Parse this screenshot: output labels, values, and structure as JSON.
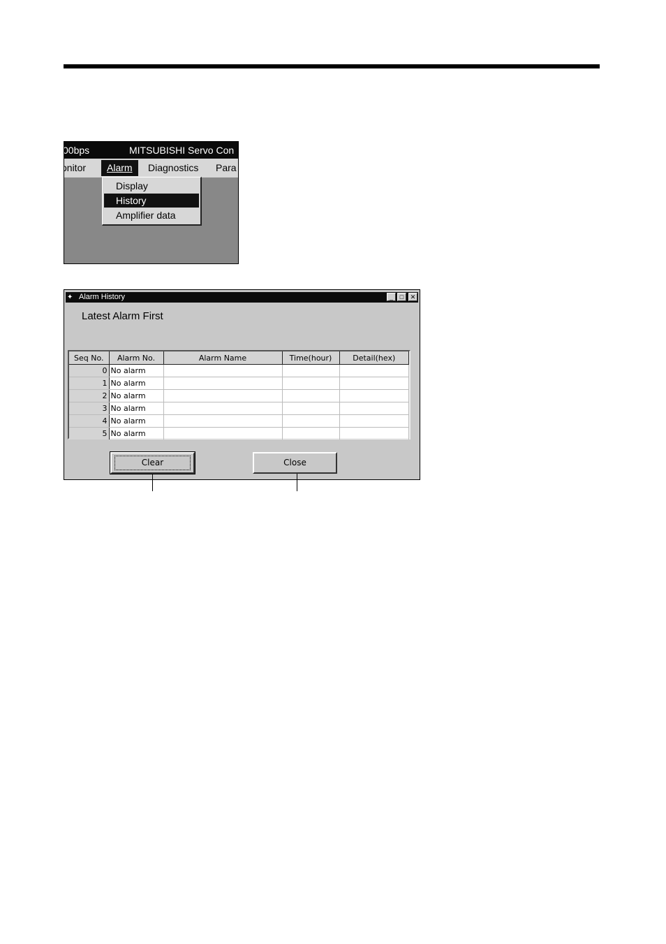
{
  "menu_screenshot": {
    "titlebar": {
      "baud": "00bps",
      "app_title": "MITSUBISHI Servo Con"
    },
    "menubar": [
      "onitor",
      "Alarm",
      "Diagnostics",
      "Para"
    ],
    "alarm_menu": [
      "Display",
      "History",
      "Amplifier data"
    ],
    "highlighted_item": "History"
  },
  "dialog": {
    "title": "Alarm History",
    "heading": "Latest Alarm First",
    "columns": [
      "Seq No.",
      "Alarm No.",
      "Alarm Name",
      "Time(hour)",
      "Detail(hex)"
    ],
    "rows": [
      {
        "seq": "0",
        "alarm_no": "No alarm",
        "alarm_name": "",
        "time": "",
        "detail": ""
      },
      {
        "seq": "1",
        "alarm_no": "No alarm",
        "alarm_name": "",
        "time": "",
        "detail": ""
      },
      {
        "seq": "2",
        "alarm_no": "No alarm",
        "alarm_name": "",
        "time": "",
        "detail": ""
      },
      {
        "seq": "3",
        "alarm_no": "No alarm",
        "alarm_name": "",
        "time": "",
        "detail": ""
      },
      {
        "seq": "4",
        "alarm_no": "No alarm",
        "alarm_name": "",
        "time": "",
        "detail": ""
      },
      {
        "seq": "5",
        "alarm_no": "No alarm",
        "alarm_name": "",
        "time": "",
        "detail": ""
      }
    ],
    "buttons": {
      "clear": "Clear",
      "close": "Close"
    }
  }
}
